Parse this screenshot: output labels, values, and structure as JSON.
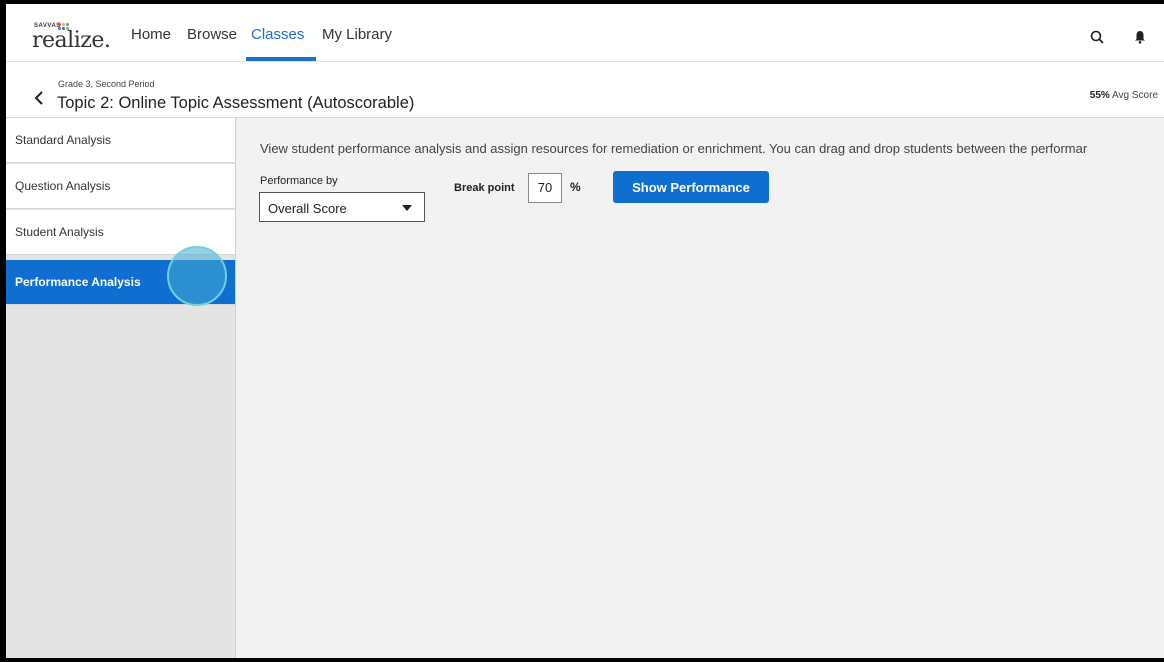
{
  "logo": {
    "brand_small": "SAVVAS",
    "word": "realize."
  },
  "nav": {
    "items": [
      "Home",
      "Browse",
      "Classes",
      "My Library"
    ],
    "active": "Classes",
    "icons": [
      "search-icon",
      "bell-icon"
    ]
  },
  "header": {
    "breadcrumb": "Grade 3, Second Period",
    "title": "Topic 2: Online Topic Assessment (Autoscorable)",
    "avg_value": "55%",
    "avg_label": "Avg Score"
  },
  "sidebar": {
    "items": [
      {
        "label": "Standard Analysis"
      },
      {
        "label": "Question Analysis"
      },
      {
        "label": "Student Analysis"
      },
      {
        "label": "Performance Analysis"
      }
    ],
    "active_index": 3
  },
  "main": {
    "description": "View student performance analysis and assign resources for remediation or enrichment. You can drag and drop students between the performar",
    "performance_by_label": "Performance by",
    "performance_by_value": "Overall Score",
    "breakpoint_label": "Break point",
    "breakpoint_value": "70",
    "percent_sign": "%",
    "show_button": "Show Performance"
  },
  "colors": {
    "accent": "#0f6fd1",
    "sidebar_bg": "#e4e4e4",
    "main_bg": "#f2f2f2"
  }
}
